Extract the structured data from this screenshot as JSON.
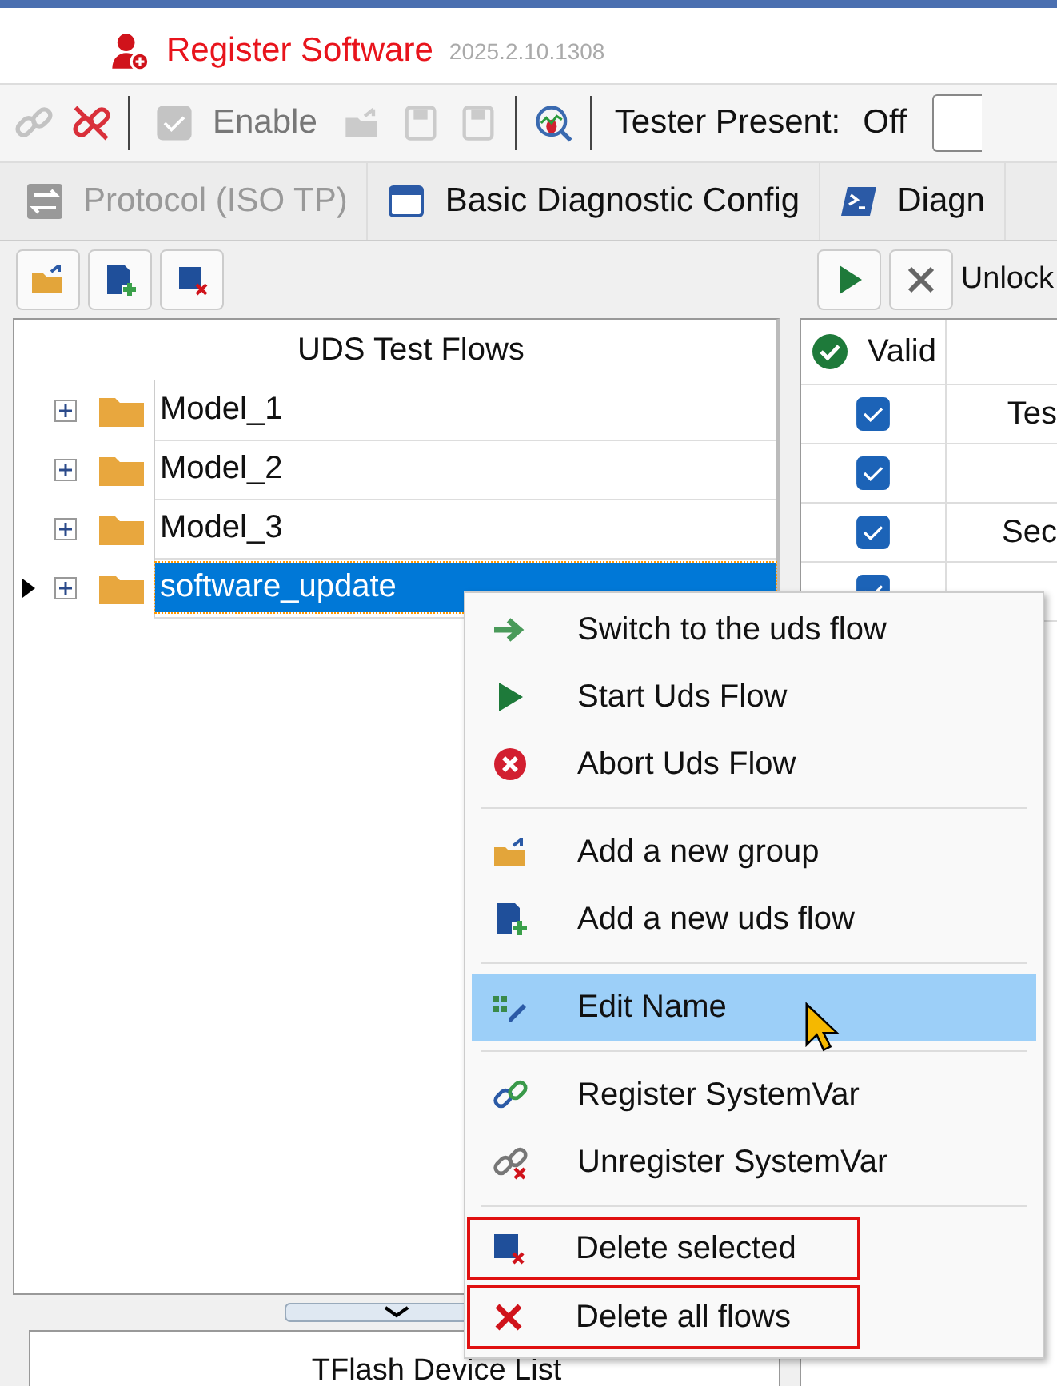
{
  "title_bar": {
    "title": "Register Software",
    "version": "2025.2.10.1308"
  },
  "toolbar": {
    "items": [
      {
        "kind": "link",
        "disabled": true
      },
      {
        "kind": "unlink",
        "disabled": false
      },
      {
        "kind": "check",
        "label": "Enable",
        "disabled": true
      },
      {
        "kind": "export",
        "disabled": true
      },
      {
        "kind": "save-down",
        "disabled": true
      },
      {
        "kind": "save-right",
        "disabled": true
      },
      {
        "kind": "bug-search",
        "disabled": false
      }
    ],
    "tester_present": {
      "label": "Tester Present:",
      "value": "Off"
    }
  },
  "tabs": [
    {
      "label": "Protocol (ISO TP)",
      "kind": "arrows",
      "disabled": true
    },
    {
      "label": "Basic Diagnostic Config",
      "kind": "window",
      "disabled": false
    },
    {
      "label": "Diagn",
      "kind": "console",
      "disabled": false
    }
  ],
  "flow_toolbar": {
    "right_label": "Unlock"
  },
  "tree": {
    "header": "UDS Test Flows",
    "rows": [
      {
        "label": "Model_1",
        "selected": false,
        "expanded": false
      },
      {
        "label": "Model_2",
        "selected": false,
        "expanded": false
      },
      {
        "label": "Model_3",
        "selected": false,
        "expanded": false
      },
      {
        "label": "software_update",
        "selected": true,
        "expanded": false
      }
    ]
  },
  "grid": {
    "header": "Valid",
    "rows": [
      {
        "checked": true,
        "column_2": "Tes"
      },
      {
        "checked": true,
        "column_2": ""
      },
      {
        "checked": true,
        "column_2": "Sec"
      },
      {
        "checked": true,
        "column_2": ""
      }
    ]
  },
  "bottom_panel": {
    "header": "TFlash Device List"
  },
  "context_menu": [
    {
      "kind": "arrow",
      "label": "Switch to the uds flow",
      "selected": false,
      "outlined": false
    },
    {
      "kind": "play",
      "label": "Start Uds Flow",
      "selected": false,
      "outlined": false
    },
    {
      "kind": "abort",
      "label": "Abort Uds Flow",
      "selected": false,
      "outlined": false
    },
    {
      "kind": "separator"
    },
    {
      "kind": "add-group",
      "label": "Add a new group",
      "selected": false,
      "outlined": false
    },
    {
      "kind": "add-flow",
      "label": "Add a new uds flow",
      "selected": false,
      "outlined": false
    },
    {
      "kind": "separator"
    },
    {
      "kind": "edit",
      "label": "Edit Name",
      "selected": true,
      "outlined": false
    },
    {
      "kind": "separator"
    },
    {
      "kind": "link",
      "label": "Register SystemVar",
      "selected": false,
      "outlined": false
    },
    {
      "kind": "unlink",
      "label": "Unregister SystemVar",
      "selected": false,
      "outlined": false
    },
    {
      "kind": "separator"
    },
    {
      "kind": "delete",
      "label": "Delete selected",
      "selected": false,
      "outlined": true
    },
    {
      "kind": "cross",
      "label": "Delete all flows",
      "selected": false,
      "outlined": true
    }
  ]
}
